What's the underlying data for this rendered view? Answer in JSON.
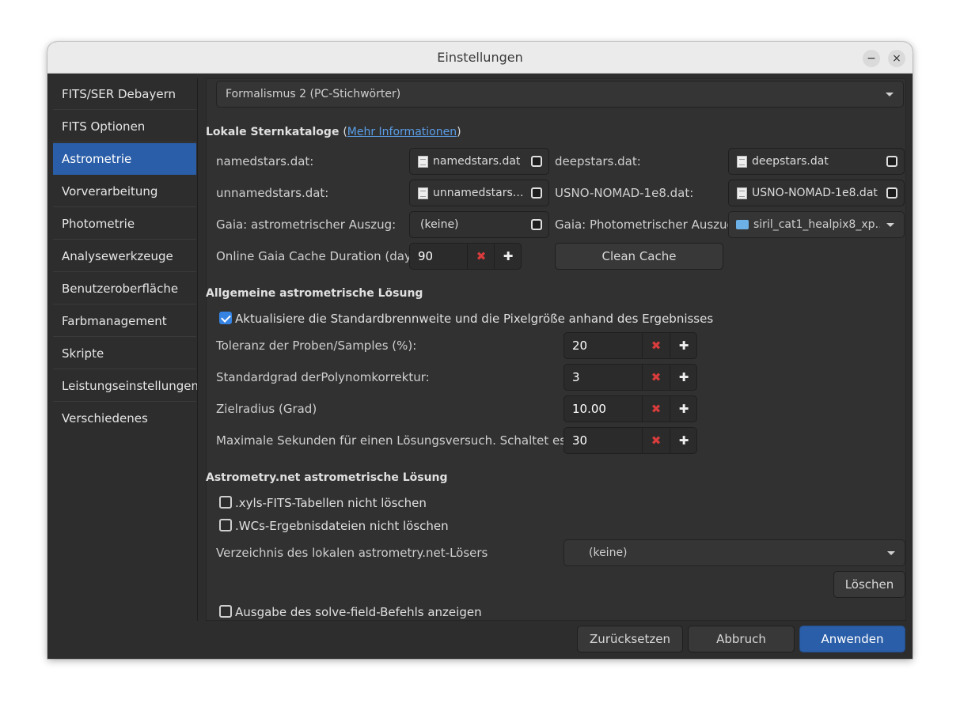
{
  "window": {
    "title": "Einstellungen",
    "minimize_icon": "−",
    "close_icon": "×"
  },
  "sidebar": {
    "items": [
      {
        "label": "FITS/SER Debayern"
      },
      {
        "label": "FITS Optionen"
      },
      {
        "label": "Astrometrie",
        "active": true
      },
      {
        "label": "Vorverarbeitung"
      },
      {
        "label": "Photometrie"
      },
      {
        "label": "Analysewerkzeuge"
      },
      {
        "label": "Benutzeroberfläche"
      },
      {
        "label": "Farbmanagement"
      },
      {
        "label": "Skripte"
      },
      {
        "label": "Leistungseinstellungen"
      },
      {
        "label": "Verschiedenes"
      }
    ]
  },
  "main": {
    "formalism_select": "Formalismus 2 (PC-Stichwörter)",
    "catalogs": {
      "title": "Lokale Sternkataloge",
      "open_paren": "(",
      "link": "Mehr Informationen",
      "close_paren": ")",
      "namedstars_label": "namedstars.dat:",
      "namedstars_value": "namedstars.dat",
      "deepstars_label": "deepstars.dat:",
      "deepstars_value": "deepstars.dat",
      "unnamedstars_label": "unnamedstars.dat:",
      "unnamedstars_value": "unnamedstars.…",
      "usno_label": "USNO-NOMAD-1e8.dat:",
      "usno_value": "USNO-NOMAD-1e8.dat",
      "gaia_astro_label": "Gaia: astrometrischer Auszug:",
      "gaia_astro_value": "(keine)",
      "gaia_photo_label": "Gaia: Photometrischer Auszug:",
      "gaia_photo_value": "siril_cat1_healpix8_xp…",
      "cache_label": "Online Gaia Cache Duration (days):",
      "cache_value": "90",
      "clean_cache": "Clean Cache"
    },
    "general": {
      "title": "Allgemeine astrometrische Lösung",
      "update_check": "Aktualisiere die Standardbrennweite und die Pixelgröße anhand des Ergebnisses",
      "tolerance_label": "Toleranz der Proben/Samples (%):",
      "tolerance_value": "20",
      "degree_label": "Standardgrad derPolynomkorrektur:",
      "degree_value": "3",
      "radius_label": "Zielradius (Grad)",
      "radius_value": "10.00",
      "max_seconds_label": "Maximale Sekunden für einen Lösungsversuch. Schaltet es ab",
      "max_seconds_value": "30"
    },
    "astrometry_net": {
      "title": "Astrometry.net astrometrische Lösung",
      "xyls_check": ".xyls-FITS-Tabellen nicht löschen",
      "wcs_check": ".WCs-Ergebnisdateien nicht löschen",
      "dir_label": "Verzeichnis des lokalen astrometry.net-Lösers",
      "dir_value": "(keine)",
      "delete_button": "Löschen",
      "show_output_check": "Ausgabe des solve-field-Befehls anzeigen"
    }
  },
  "footer": {
    "reset": "Zurücksetzen",
    "cancel": "Abbruch",
    "apply": "Anwenden"
  },
  "icons": {
    "minus": "✖",
    "plus": "✚"
  },
  "colors": {
    "accent": "#2a5ea8",
    "minus_icon": "#d83c3c",
    "link": "#5a9ee8"
  }
}
